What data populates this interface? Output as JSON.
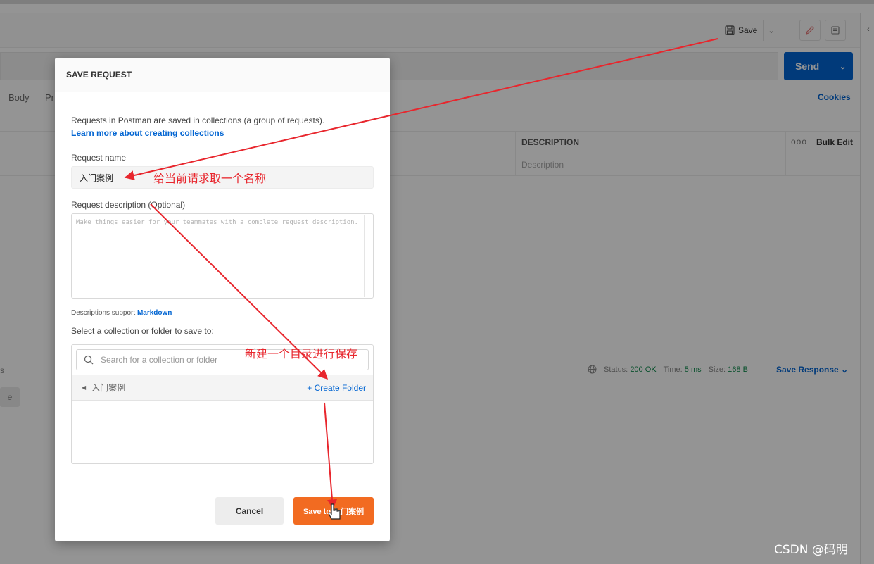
{
  "toolbar": {
    "save_label": "Save",
    "save_caret": "⌄"
  },
  "request": {
    "send_label": "Send",
    "send_caret": "⌄",
    "tabs": [
      "Body",
      "Pr"
    ],
    "cookies_label": "Cookies"
  },
  "params": {
    "description_header": "DESCRIPTION",
    "bulk_edit_label": "Bulk Edit",
    "more_label": "ooo",
    "description_placeholder": "Description"
  },
  "response": {
    "left_stub": "s",
    "button_stub": "e",
    "status_label": "Status:",
    "status_value": "200 OK",
    "time_label": "Time:",
    "time_value": "5 ms",
    "size_label": "Size:",
    "size_value": "168 B",
    "save_response_label": "Save Response"
  },
  "modal": {
    "title": "SAVE REQUEST",
    "intro_text": "Requests in Postman are saved in collections (a group of requests).",
    "learn_more": "Learn more about creating collections",
    "request_name_label": "Request name",
    "request_name_value": "入门案例",
    "description_label": "Request description (Optional)",
    "description_placeholder": "Make things easier for your teammates with a complete request description.",
    "markdown_note": "Descriptions support",
    "markdown_link": "Markdown",
    "collection_label": "Select a collection or folder to save to:",
    "search_placeholder": "Search for a collection or folder",
    "current_folder": "入门案例",
    "create_folder_label": "+ Create Folder",
    "cancel_label": "Cancel",
    "save_button_label": "Save to 入门案例"
  },
  "annotations": {
    "name_hint": "给当前请求取一个名称",
    "folder_hint": "新建一个目录进行保存",
    "color": "#e8262d"
  },
  "watermark": "CSDN @码明",
  "colors": {
    "accent_blue": "#0265d2",
    "save_orange": "#f26b21",
    "annotation_red": "#e8262d"
  }
}
